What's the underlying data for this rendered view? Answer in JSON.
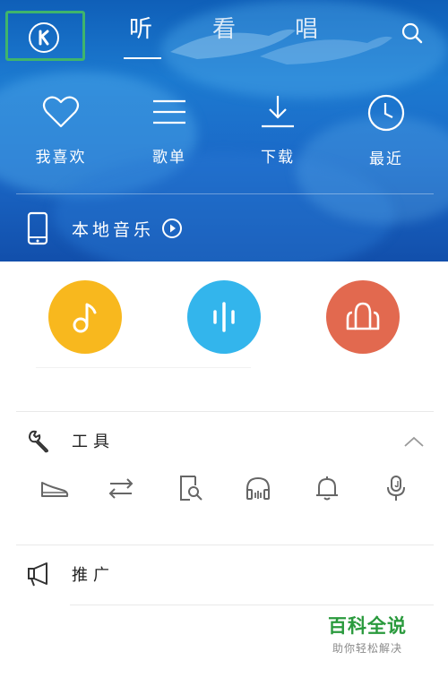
{
  "header": {
    "tabs": [
      {
        "label": "听",
        "active": true
      },
      {
        "label": "看",
        "active": false
      },
      {
        "label": "唱",
        "active": false
      }
    ]
  },
  "quick_actions": [
    {
      "label": "我喜欢",
      "icon": "heart-icon"
    },
    {
      "label": "歌单",
      "icon": "list-icon"
    },
    {
      "label": "下载",
      "icon": "download-icon"
    },
    {
      "label": "最近",
      "icon": "clock-icon"
    }
  ],
  "local_music": {
    "label": "本地音乐",
    "icon": "phone-icon"
  },
  "feature_circles": [
    {
      "icon": "music-note-icon",
      "color": "#f8b81e"
    },
    {
      "icon": "sound-wave-icon",
      "color": "#33b5ec"
    },
    {
      "icon": "group-icon",
      "color": "#e2694f"
    }
  ],
  "tools_section": {
    "title": "工具",
    "icons": [
      "shoe-icon",
      "transfer-icon",
      "document-search-icon",
      "headphones-icon",
      "bell-icon",
      "mic-icon"
    ]
  },
  "promo_section": {
    "title": "推广"
  },
  "watermark": {
    "title": "百科全说",
    "subtitle": "助你轻松解决"
  },
  "colors": {
    "accent_green": "#3fb46c",
    "hero_blue": "#1b6fc9",
    "brand_green": "#2a9a3d"
  }
}
